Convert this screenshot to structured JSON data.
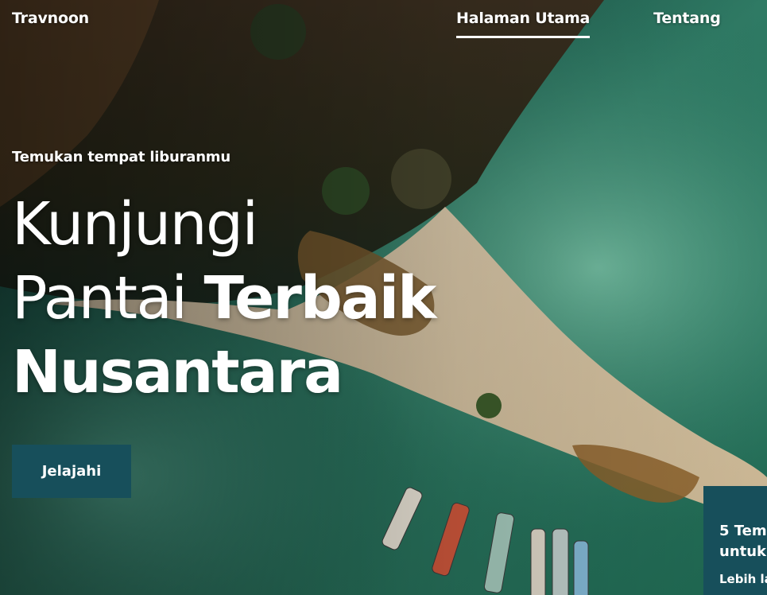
{
  "nav": {
    "brand": "Travnoon",
    "links": [
      {
        "label": "Halaman Utama",
        "active": true
      },
      {
        "label": "Tentang",
        "active": false
      }
    ]
  },
  "hero": {
    "tagline": "Temukan tempat liburanmu",
    "headline": {
      "line1": "Kunjungi",
      "line2_light": "Pantai ",
      "line2_bold": "Terbaik",
      "line3_bold": "Nusantara"
    },
    "cta_label": "Jelajahi"
  },
  "card": {
    "title_line1": "5 Tem",
    "title_line2": "untuk",
    "link_label": "Lebih la"
  },
  "colors": {
    "accent": "#174f5b",
    "text": "#ffffff"
  }
}
